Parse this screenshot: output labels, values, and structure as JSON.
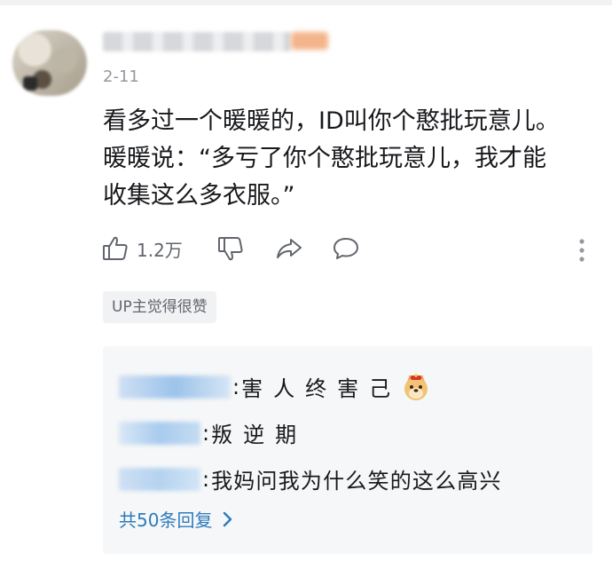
{
  "comment": {
    "date": "2-11",
    "lines": [
      "看多过一个暖暖的，ID叫你个憨批玩意儿。",
      "暖暖说：“多亏了你个憨批玩意儿，我才能",
      "收集这么多衣服。”"
    ]
  },
  "actions": {
    "like_count": "1.2万",
    "icons": [
      "thumbs-up-icon",
      "thumbs-down-icon",
      "share-icon",
      "comment-icon",
      "more-vertical-icon"
    ]
  },
  "up_tag": "UP主觉得很赞",
  "replies": {
    "items": [
      {
        "text": "害人终害己",
        "emote": "doge-emote"
      },
      {
        "text": "叛逆期"
      },
      {
        "text": "我妈问我为什么笑的这么高兴"
      }
    ],
    "separator": ":",
    "more_label": "共50条回复"
  },
  "colors": {
    "link": "#2e7bbd",
    "muted": "#9499a0",
    "reply_bg": "#f6f7f8"
  }
}
